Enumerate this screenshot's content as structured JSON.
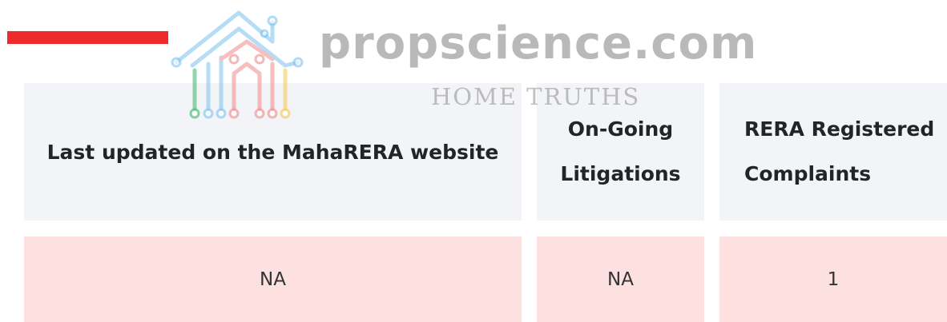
{
  "brand": {
    "name": "propscience.com",
    "tagline": "HOME TRUTHS",
    "accent_color": "#ee2a2f"
  },
  "table": {
    "headers": [
      "Last updated on the MahaRERA website",
      "On-Going Litigations",
      "RERA Registered Complaints"
    ],
    "header_lines": {
      "litigations": [
        "On-Going",
        "Litigations"
      ],
      "complaints": [
        "RERA Registered",
        "Complaints"
      ]
    },
    "values": [
      "NA",
      "NA",
      "1"
    ]
  },
  "colors": {
    "header_bg": "#f3f4f7",
    "value_bg": "#fde0e0"
  }
}
